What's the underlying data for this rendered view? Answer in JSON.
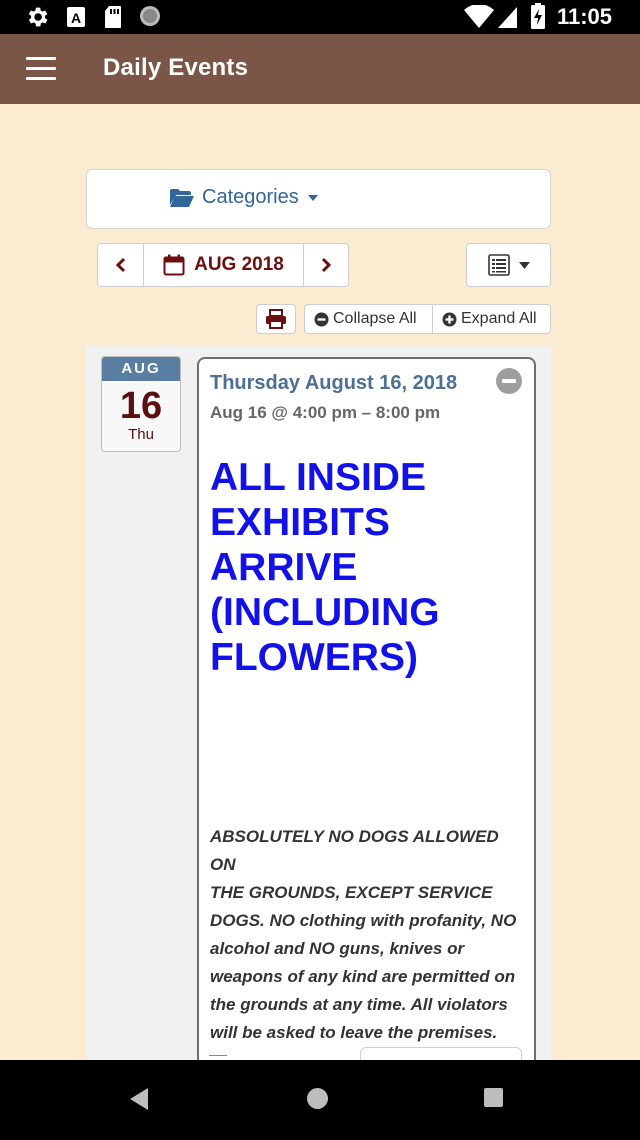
{
  "status_bar": {
    "time": "11:05",
    "icons": [
      "gear-icon",
      "text-a-icon",
      "sd-card-icon",
      "circle-icon",
      "wifi-icon",
      "signal-icon",
      "battery-charging-icon"
    ]
  },
  "app_bar": {
    "title": "Daily Events",
    "menu_icon": "hamburger-menu-icon"
  },
  "filters": {
    "categories_label": "Categories",
    "categories_icon": "folder-open-icon"
  },
  "calendar_nav": {
    "prev_icon": "chevron-left-icon",
    "month_label": "AUG 2018",
    "calendar_icon": "calendar-icon",
    "next_icon": "chevron-right-icon",
    "view_icon": "list-view-icon"
  },
  "actions": {
    "print_icon": "print-icon",
    "collapse_label": "Collapse All",
    "expand_label": "Expand All"
  },
  "event": {
    "badge": {
      "month": "AUG",
      "day": "16",
      "weekday": "Thu"
    },
    "date_heading": "Thursday August 16, 2018",
    "time_range": "Aug 16 @ 4:00 pm – 8:00 pm",
    "title": "ALL INSIDE EXHIBITS ARRIVE (INCLUDING FLOWERS)",
    "description_lines": [
      "ABSOLUTELY NO DOGS ALLOWED ON",
      "THE GROUNDS, EXCEPT SERVICE",
      "DOGS.  NO clothing with profanity, NO",
      "alcohol and NO guns, knives or",
      "weapons of any kind are permitted on",
      "the grounds at any time.  All violators",
      "will be asked to leave the premises."
    ]
  },
  "colors": {
    "app_bar": "#7b5646",
    "page_background": "#fbebd0",
    "link_blue": "#336699",
    "title_blue": "#1212e8",
    "month_red": "#6b0f0f",
    "badge_header": "#5a7ea1"
  },
  "system_nav": {
    "back_icon": "back-triangle-icon",
    "home_icon": "home-circle-icon",
    "recents_icon": "recents-square-icon"
  }
}
